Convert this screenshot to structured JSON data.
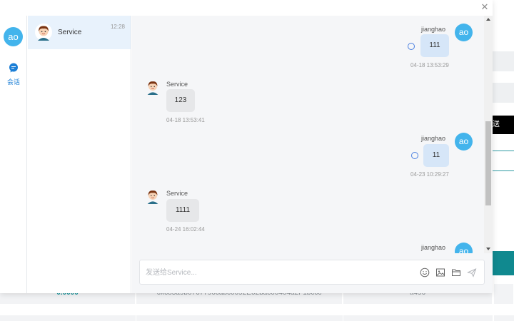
{
  "background": {
    "black_button_text": "送",
    "row_cells": [
      "0.0000",
      "0xc85a9b0767790cabc0092E02bac00404a2F1bccc",
      "tt496"
    ]
  },
  "modal": {
    "close_icon": "close-icon",
    "rail": {
      "avatar_text": "ao",
      "chat_label": "会话"
    },
    "conversations": [
      {
        "name": "Service",
        "time": "12:28"
      }
    ],
    "messages": [
      {
        "side": "out",
        "sender": "jianghao",
        "avatar_text": "ao",
        "text": "111",
        "time": "04-18 13:53:29"
      },
      {
        "side": "in",
        "sender": "Service",
        "text": "123",
        "time": "04-18 13:53:41"
      },
      {
        "side": "out",
        "sender": "jianghao",
        "avatar_text": "ao",
        "text": "11",
        "time": "04-23 10:29:27"
      },
      {
        "side": "in",
        "sender": "Service",
        "text": "1111",
        "time": "04-24 16:02:44"
      },
      {
        "side": "out",
        "sender": "jianghao",
        "avatar_text": "ao",
        "text": "",
        "time": ""
      }
    ],
    "input": {
      "placeholder": "发送给Service...",
      "value": ""
    },
    "tools": [
      "emoji-icon",
      "image-icon",
      "folder-icon",
      "send-icon"
    ]
  },
  "colors": {
    "accent_blue": "#43b4ec",
    "bubble_out": "#d6e6f8",
    "bubble_in": "#e6e7e9",
    "teal": "#10898f"
  }
}
